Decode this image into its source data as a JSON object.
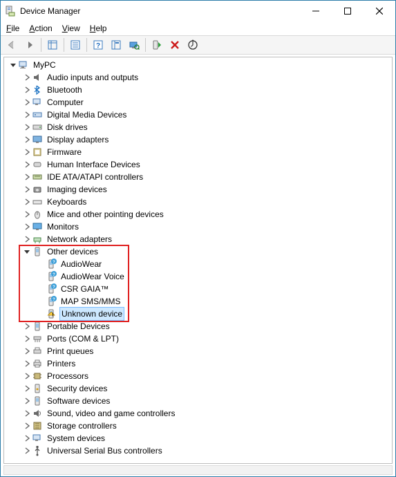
{
  "window": {
    "title": "Device Manager"
  },
  "menu": {
    "file": "File",
    "action": "Action",
    "view": "View",
    "help": "Help"
  },
  "tree": {
    "root": "MyPC",
    "cat": {
      "audio": "Audio inputs and outputs",
      "bluetooth": "Bluetooth",
      "computer": "Computer",
      "dmd": "Digital Media Devices",
      "disk": "Disk drives",
      "display": "Display adapters",
      "firmware": "Firmware",
      "hid": "Human Interface Devices",
      "ide": "IDE ATA/ATAPI controllers",
      "imaging": "Imaging devices",
      "keyboards": "Keyboards",
      "mice": "Mice and other pointing devices",
      "monitors": "Monitors",
      "network": "Network adapters",
      "other": "Other devices",
      "portable": "Portable Devices",
      "ports": "Ports (COM & LPT)",
      "printqueues": "Print queues",
      "printers": "Printers",
      "processors": "Processors",
      "security": "Security devices",
      "software": "Software devices",
      "sound": "Sound, video and game controllers",
      "storage": "Storage controllers",
      "system": "System devices",
      "usb": "Universal Serial Bus controllers"
    },
    "other_children": {
      "audiowear": "AudioWear",
      "audiowear_voice": "AudioWear Voice",
      "csr_gaia": "CSR GAIA™",
      "map": "MAP SMS/MMS",
      "unknown": "Unknown device"
    }
  }
}
